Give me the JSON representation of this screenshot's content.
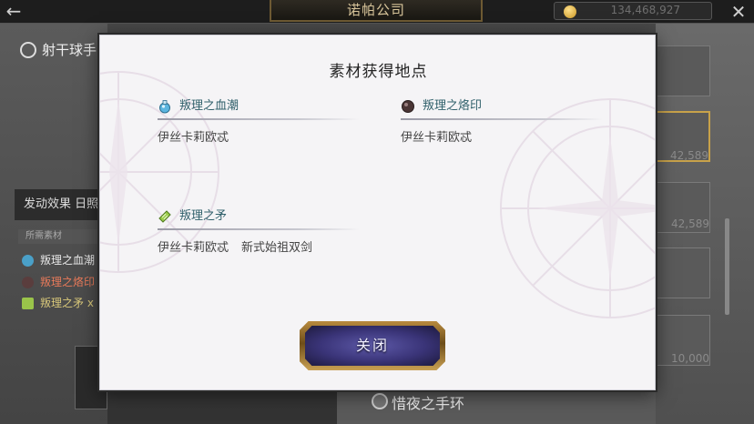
{
  "header": {
    "title": "诺帕公司",
    "currency_value": "134,468,927"
  },
  "background": {
    "skill_title": "射干球手",
    "effect_label": "发动效果 日照",
    "materials_header": "所需素材",
    "material_rows": [
      "叛理之血潮",
      "叛理之烙印",
      "叛理之矛 x"
    ],
    "right_numbers": [
      "42,589",
      "42,589",
      "10,000"
    ],
    "bottom_item": "惜夜之手环"
  },
  "modal": {
    "title": "素材获得地点",
    "materials": [
      {
        "name": "叛理之血潮",
        "icon": "blue-potion-icon",
        "sources": [
          "伊丝卡莉欧忒"
        ]
      },
      {
        "name": "叛理之烙印",
        "icon": "dark-orb-icon",
        "sources": [
          "伊丝卡莉欧忒"
        ]
      },
      {
        "name": "叛理之矛",
        "icon": "green-ticket-icon",
        "sources": [
          "伊丝卡莉欧忒",
          "新式始祖双剑"
        ]
      }
    ],
    "close_label": "关闭"
  },
  "colors": {
    "modal_bg": "#f5f4f6",
    "material_name": "#2f5f6a",
    "button_frame": "#b88a3e",
    "button_fill": "#3a3478"
  }
}
